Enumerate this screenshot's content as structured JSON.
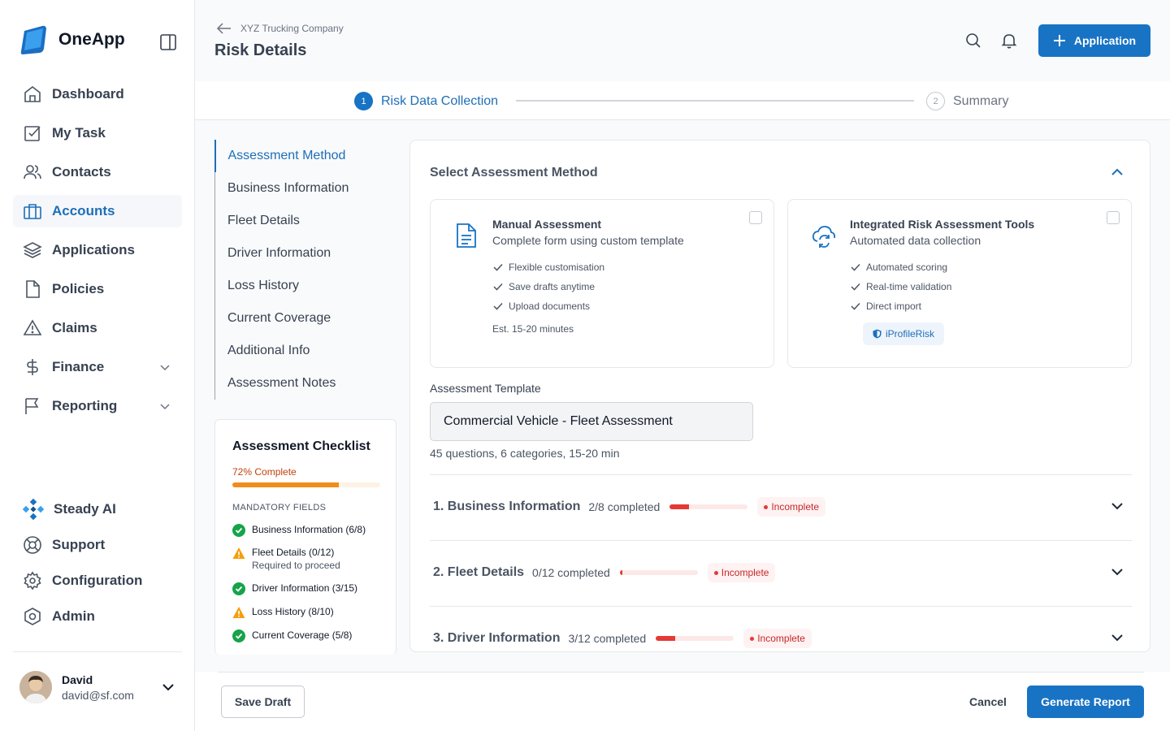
{
  "app": {
    "name": "OneApp"
  },
  "colors": {
    "accent": "#1873c4",
    "danger": "#e53935",
    "warning": "#f08c1a",
    "success": "#16a34a"
  },
  "sidebar": {
    "items": [
      {
        "label": "Dashboard",
        "icon": "home-icon"
      },
      {
        "label": "My Task",
        "icon": "task-check-icon"
      },
      {
        "label": "Contacts",
        "icon": "users-icon"
      },
      {
        "label": "Accounts",
        "icon": "briefcase-icon",
        "active": true
      },
      {
        "label": "Applications",
        "icon": "layers-icon"
      },
      {
        "label": "Policies",
        "icon": "document-icon"
      },
      {
        "label": "Claims",
        "icon": "warning-triangle-icon"
      },
      {
        "label": "Finance",
        "icon": "dollar-icon",
        "expandable": true
      },
      {
        "label": "Reporting",
        "icon": "flag-icon",
        "expandable": true
      }
    ],
    "bottom_items": [
      {
        "label": "Steady AI",
        "icon": "ai-diamond-icon"
      },
      {
        "label": "Support",
        "icon": "lifebuoy-icon"
      },
      {
        "label": "Configuration",
        "icon": "gear-icon"
      },
      {
        "label": "Admin",
        "icon": "admin-shield-icon"
      }
    ],
    "user": {
      "name": "David",
      "email": "david@sf.com"
    }
  },
  "header": {
    "breadcrumb": "XYZ Trucking Company",
    "title": "Risk Details",
    "application_button": "Application"
  },
  "stepper": {
    "steps": [
      {
        "number": "1",
        "label": "Risk Data Collection",
        "state": "active"
      },
      {
        "number": "2",
        "label": "Summary",
        "state": "pending"
      }
    ]
  },
  "subnav": {
    "items": [
      {
        "label": "Assessment Method",
        "active": true
      },
      {
        "label": "Business Information"
      },
      {
        "label": "Fleet Details"
      },
      {
        "label": "Driver Information"
      },
      {
        "label": "Loss History"
      },
      {
        "label": "Current Coverage"
      },
      {
        "label": "Additional Info"
      },
      {
        "label": "Assessment Notes"
      }
    ]
  },
  "checklist": {
    "title": "Assessment Checklist",
    "complete_label": "72% Complete",
    "complete_fraction": 0.72,
    "mandatory_label": "MANDATORY FIELDS",
    "items": [
      {
        "label": "Business Information (6/8)",
        "status": "done"
      },
      {
        "label": "Fleet Details (0/12)",
        "sublabel": "Required to proceed",
        "status": "warning"
      },
      {
        "label": "Driver Information (3/15)",
        "status": "done"
      },
      {
        "label": "Loss History (8/10)",
        "status": "warning"
      },
      {
        "label": "Current Coverage (5/8)",
        "status": "done"
      }
    ]
  },
  "assessment": {
    "title": "Select Assessment Method",
    "cards": [
      {
        "title": "Manual Assessment",
        "subtitle": "Complete form using custom template",
        "features": [
          "Flexible customisation",
          "Save drafts anytime",
          "Upload documents"
        ],
        "estimate": "Est. 15-20 minutes",
        "icon": "document-text-icon"
      },
      {
        "title": "Integrated Risk Assessment Tools",
        "subtitle": "Automated data collection",
        "features": [
          "Automated scoring",
          "Real-time validation",
          "Direct import"
        ],
        "badge": "iProfileRisk",
        "icon": "sync-cloud-icon"
      }
    ],
    "template": {
      "label": "Assessment Template",
      "value": "Commercial Vehicle - Fleet Assessment",
      "meta": "45 questions, 6 categories, 15-20 min"
    },
    "sections": [
      {
        "title": "1. Business Information",
        "count": "2/8 completed",
        "progress": 0.25,
        "status": "Incomplete"
      },
      {
        "title": "2. Fleet Details",
        "count": "0/12 completed",
        "progress": 0.0,
        "status": "Incomplete"
      },
      {
        "title": "3. Driver Information",
        "count": "3/12 completed",
        "progress": 0.25,
        "status": "Incomplete"
      }
    ]
  },
  "footer": {
    "save_draft": "Save Draft",
    "cancel": "Cancel",
    "generate": "Generate Report"
  }
}
